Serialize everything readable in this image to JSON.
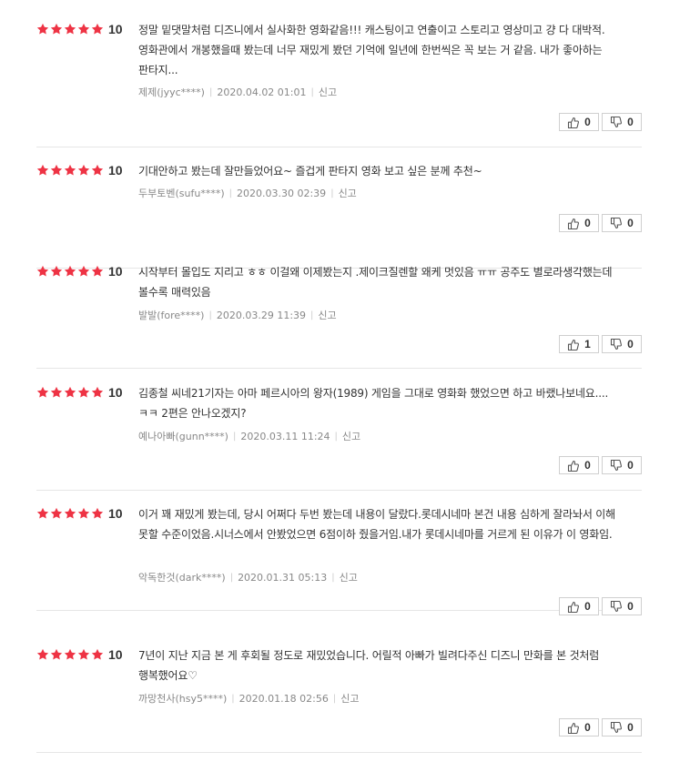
{
  "accent_color": "#ee3344",
  "reviews": [
    {
      "stars": 5,
      "score": "10",
      "text": "정말 밑댓말처럼 디즈니에서 실사화한 영화같음!!! 캐스팅이고 연출이고 스토리고 영상미고 걍 다 대박적. 영화관에서 개봉했을때 봤는데 너무 재밌게 봤던 기억에 일년에 한번씩은 꼭 보는 거 같음. 내가 좋아하는 판타지...",
      "author": "제제(jyyc****)",
      "date": "2020.04.02 01:01",
      "report": "신고",
      "likes": "0",
      "dislikes": "0"
    },
    {
      "stars": 5,
      "score": "10",
      "text": "기대안하고 봤는데 잘만들었어요~ 즐겁게 판타지 영화 보고 싶은 분께 추천~",
      "author": "두부토벤(sufu****)",
      "date": "2020.03.30 02:39",
      "report": "신고",
      "likes": "0",
      "dislikes": "0"
    },
    {
      "stars": 5,
      "score": "10",
      "text": "시작부터 몰입도 지리고 ㅎㅎ 이걸왜 이제봤는지 .제이크질렌할 왜케 멋있음 ㅠㅠ 공주도 별로라생각했는데 볼수록 매력있음",
      "author": "발발(fore****)",
      "date": "2020.03.29 11:39",
      "report": "신고",
      "likes": "1",
      "dislikes": "0"
    },
    {
      "stars": 5,
      "score": "10",
      "text": "김종철 씨네21기자는 아마 페르시아의 왕자(1989) 게임을 그대로 영화화 했었으면 하고 바랬나보네요.... ㅋㅋ 2편은 안나오겠지?",
      "author": "예나아빠(gunn****)",
      "date": "2020.03.11 11:24",
      "report": "신고",
      "likes": "0",
      "dislikes": "0"
    },
    {
      "stars": 5,
      "score": "10",
      "text": "이거 꽤 재밌게 봤는데, 당시 어쩌다 두번 봤는데 내용이 달랐다.롯데시네마 본건 내용 심하게 잘라놔서 이해 못할 수준이었음.시너스에서 안봤었으면 6점이하 줬을거임.내가 롯데시네마를 거르게 된 이유가 이 영화임.",
      "author": "악독한것(dark****)",
      "date": "2020.01.31 05:13",
      "report": "신고",
      "likes": "0",
      "dislikes": "0"
    },
    {
      "stars": 5,
      "score": "10",
      "text": "7년이 지난 지금 본 게 후회될 정도로 재밌었습니다. 어릴적 아빠가 빌려다주신 디즈니 만화를 본 것처럼 행복했어요♡",
      "author": "까망천사(hsy5****)",
      "date": "2020.01.18 02:56",
      "report": "신고",
      "likes": "0",
      "dislikes": "0"
    }
  ]
}
